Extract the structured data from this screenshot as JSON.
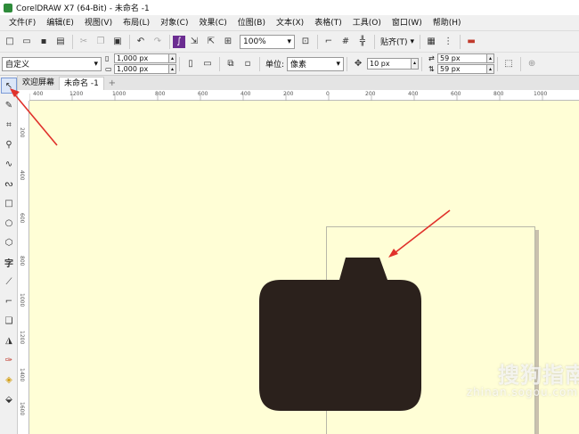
{
  "window": {
    "title": "CorelDRAW X7 (64-Bit) - 未命名 -1"
  },
  "menu": [
    "文件(F)",
    "编辑(E)",
    "视图(V)",
    "布局(L)",
    "对象(C)",
    "效果(C)",
    "位图(B)",
    "文本(X)",
    "表格(T)",
    "工具(O)",
    "窗口(W)",
    "帮助(H)"
  ],
  "toolbar": {
    "zoom": "100%",
    "snap_label": "贴齐(T)"
  },
  "propbar": {
    "preset": "自定义",
    "width": "1,000 px",
    "height": "1,000 px",
    "units_label": "单位:",
    "units_value": "像素",
    "nudge": "10 px",
    "dup_x": "59 px",
    "dup_y": "59 px"
  },
  "tabs": [
    {
      "label": "欢迎屏幕"
    },
    {
      "label": "未命名 -1"
    }
  ],
  "ruler_h": [
    "400",
    "1200",
    "1000",
    "800",
    "600",
    "400",
    "200",
    "0",
    "200",
    "400",
    "600",
    "800",
    "1000"
  ],
  "ruler_v": [
    "200",
    "400",
    "600",
    "800",
    "1000",
    "1200",
    "1400",
    "1600",
    "1800"
  ],
  "watermark": {
    "brand": "搜狗指南",
    "url": "zhinan.sogou.com"
  },
  "colors": {
    "canvas": "#fffed6",
    "shape": "#2b211c",
    "arrow": "#e0312b"
  }
}
